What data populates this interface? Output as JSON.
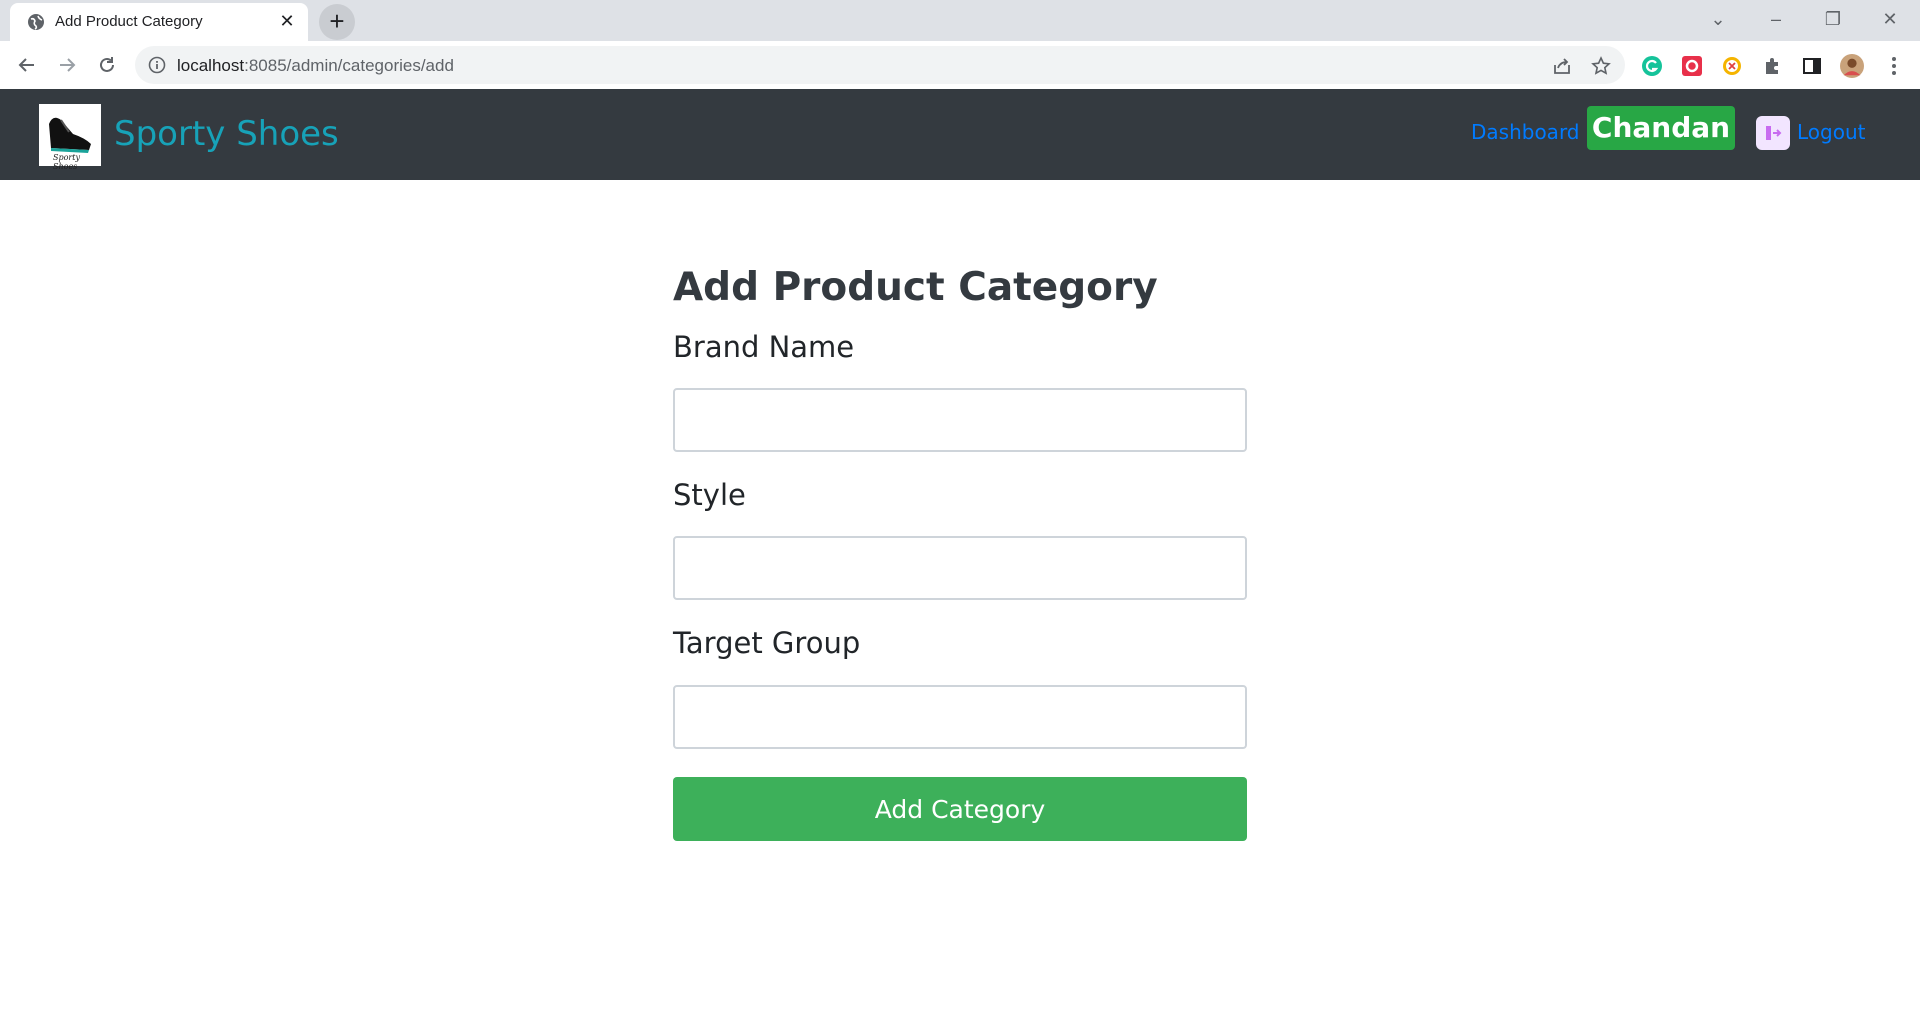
{
  "browser": {
    "tab_title": "Add Product Category",
    "url_host": "localhost",
    "url_path": ":8085/admin/categories/add"
  },
  "navbar": {
    "brand": "Sporty Shoes",
    "logo_caption": "Sporty Shoes",
    "dashboard_link": "Dashboard",
    "user_name": "Chandan",
    "logout_link": "Logout",
    "colors": {
      "bg": "#343a40",
      "brand": "#17a2b8",
      "link": "#007bff",
      "badge": "#28a745"
    }
  },
  "form": {
    "title": "Add Product Category",
    "fields": [
      {
        "label": "Brand Name",
        "value": ""
      },
      {
        "label": "Style",
        "value": ""
      },
      {
        "label": "Target Group",
        "value": ""
      }
    ],
    "submit_label": "Add Category",
    "submit_color": "#3db05a"
  }
}
